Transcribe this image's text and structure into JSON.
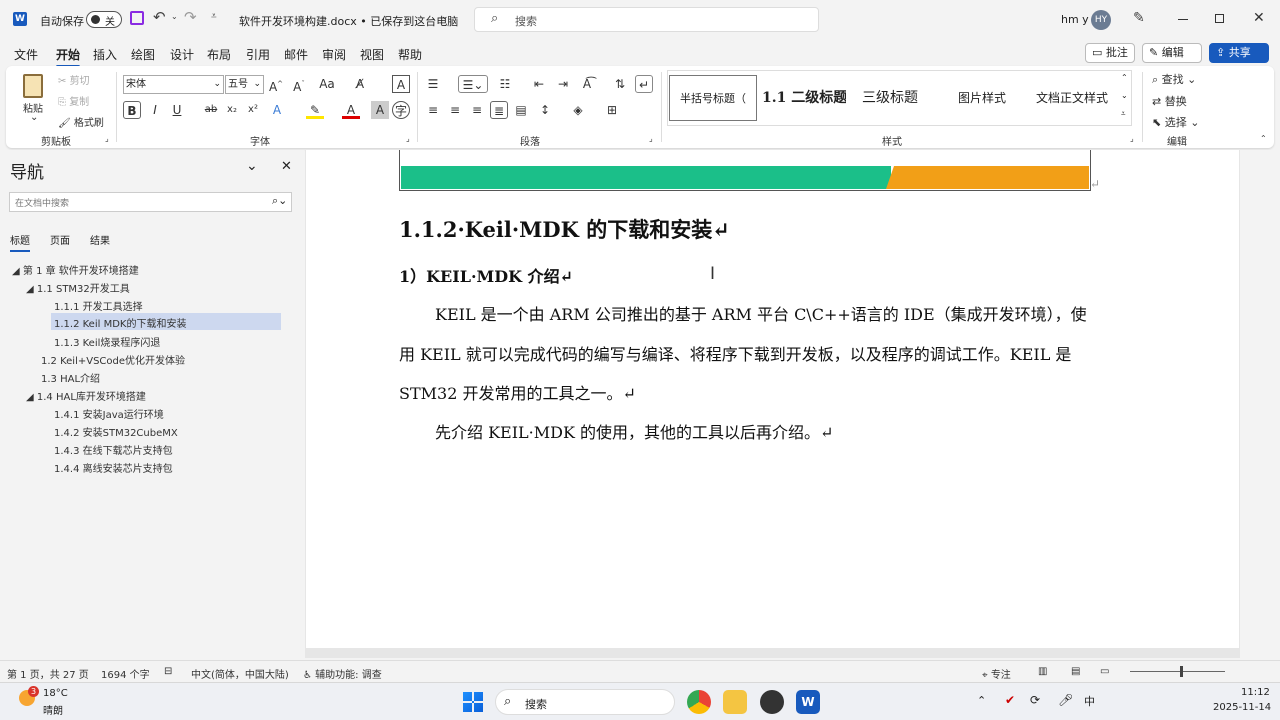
{
  "titlebar": {
    "autosave_label": "自动保存",
    "autosave_state": "关",
    "doc_title": "软件开发环境构建.docx • 已保存到这台电脑",
    "search_placeholder": "搜索",
    "user_name": "hm y",
    "user_initials": "HY"
  },
  "tabs": [
    "文件",
    "开始",
    "插入",
    "绘图",
    "设计",
    "布局",
    "引用",
    "邮件",
    "审阅",
    "视图",
    "帮助"
  ],
  "tab_actions": {
    "comment": "批注",
    "edit": "编辑",
    "share": "共享"
  },
  "ribbon": {
    "clipboard": {
      "paste": "粘贴",
      "cut": "剪切",
      "copy": "复制",
      "format_painter": "格式刷",
      "label": "剪贴板"
    },
    "font": {
      "name": "宋体",
      "size": "五号",
      "label": "字体",
      "case": "Aa",
      "grow": "A^",
      "shrink": "Aˇ"
    },
    "paragraph": {
      "label": "段落"
    },
    "styles": {
      "items": [
        "半括号标题（",
        "1.1 二级标题",
        "三级标题",
        "图片样式",
        "文档正文样式"
      ],
      "label": "样式"
    },
    "editing": {
      "find": "查找",
      "replace": "替换",
      "select": "选择",
      "label": "编辑"
    }
  },
  "nav": {
    "title": "导航",
    "search_placeholder": "在文档中搜索",
    "tabs": [
      "标题",
      "页面",
      "结果"
    ],
    "items": [
      "第 1 章 软件开发环境搭建",
      "1.1 STM32开发工具",
      "1.1.1 开发工具选择",
      "1.1.2 Keil MDK的下载和安装",
      "1.1.3 Keil烧录程序闪退",
      "1.2 Keil+VSCode优化开发体验",
      "1.3 HAL介绍",
      "1.4 HAL库开发环境搭建",
      "1.4.1 安装Java运行环境",
      "1.4.2 安装STM32CubeMX",
      "1.4.3 在线下载芯片支持包",
      "1.4.4 离线安装芯片支持包"
    ]
  },
  "doc": {
    "heading": "1.1.2·Keil·MDK 的下载和安装↵",
    "subheading": "1）KEIL·MDK 介绍↵",
    "para1_line1": "KEIL 是一个由 ARM 公司推出的基于 ARM 平台 C\\C++语言的 IDE（集成开发环境），使",
    "para1_line2": "用 KEIL 就可以完成代码的编写与编译、将程序下载到开发板，以及程序的调试工作。KEIL 是",
    "para1_line3": "STM32 开发常用的工具之一。↵",
    "para2": "先介绍 KEIL·MDK 的使用，其他的工具以后再介绍。↵",
    "colors": {
      "bar_green": "#1bbf89",
      "bar_orange": "#f29f17"
    }
  },
  "status": {
    "page": "第 1 页，共 27 页",
    "words": "1694 个字",
    "language": "中文(简体，中国大陆)",
    "accessibility": "辅助功能: 调查",
    "focus": "专注"
  },
  "taskbar": {
    "weather_temp": "18°C",
    "weather_desc": "晴朗",
    "search": "搜索",
    "time": "11:12",
    "date": "2025-11-14",
    "badge": "3"
  }
}
